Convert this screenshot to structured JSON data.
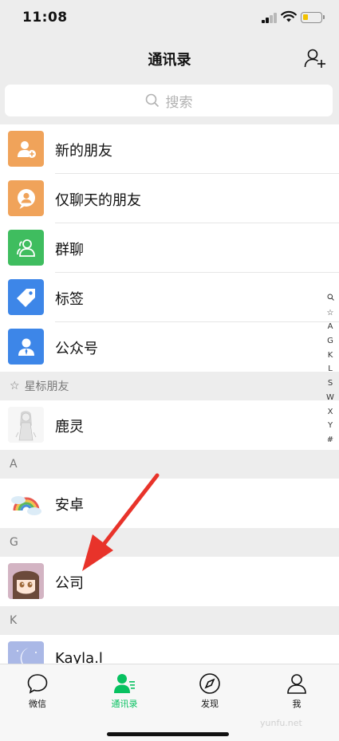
{
  "status_bar": {
    "time": "11:08"
  },
  "nav": {
    "title": "通讯录",
    "add_friend_icon": "add-friend-icon"
  },
  "search": {
    "placeholder": "搜索"
  },
  "function_items": [
    {
      "label": "新的朋友",
      "icon": "add-friend-icon",
      "color": "#f0a35a"
    },
    {
      "label": "仅聊天的朋友",
      "icon": "chat-only-friend-icon",
      "color": "#f0a35a"
    },
    {
      "label": "群聊",
      "icon": "group-chat-icon",
      "color": "#3fbd5f"
    },
    {
      "label": "标签",
      "icon": "tag-icon",
      "color": "#3d86e8"
    },
    {
      "label": "公众号",
      "icon": "official-account-icon",
      "color": "#3d86e8"
    }
  ],
  "sections": {
    "starred": {
      "header": "星标朋友",
      "contacts": [
        {
          "name": "鹿灵"
        }
      ]
    },
    "a": {
      "header": "A",
      "contacts": [
        {
          "name": "安卓"
        }
      ]
    },
    "g": {
      "header": "G",
      "contacts": [
        {
          "name": "公司"
        }
      ]
    },
    "k": {
      "header": "K",
      "contacts": [
        {
          "name": "Kayla.l"
        }
      ]
    }
  },
  "index_letters": [
    "☆",
    "A",
    "G",
    "K",
    "L",
    "S",
    "W",
    "X",
    "Y",
    "#"
  ],
  "tabs": [
    {
      "label": "微信",
      "icon": "chat-bubble-icon",
      "active": false
    },
    {
      "label": "通讯录",
      "icon": "contacts-icon",
      "active": true
    },
    {
      "label": "发现",
      "icon": "compass-icon",
      "active": false
    },
    {
      "label": "我",
      "icon": "person-icon",
      "active": false
    }
  ],
  "colors": {
    "accent": "#07c160",
    "annotation_arrow": "#e8332a"
  },
  "watermark": "yunfu.net"
}
